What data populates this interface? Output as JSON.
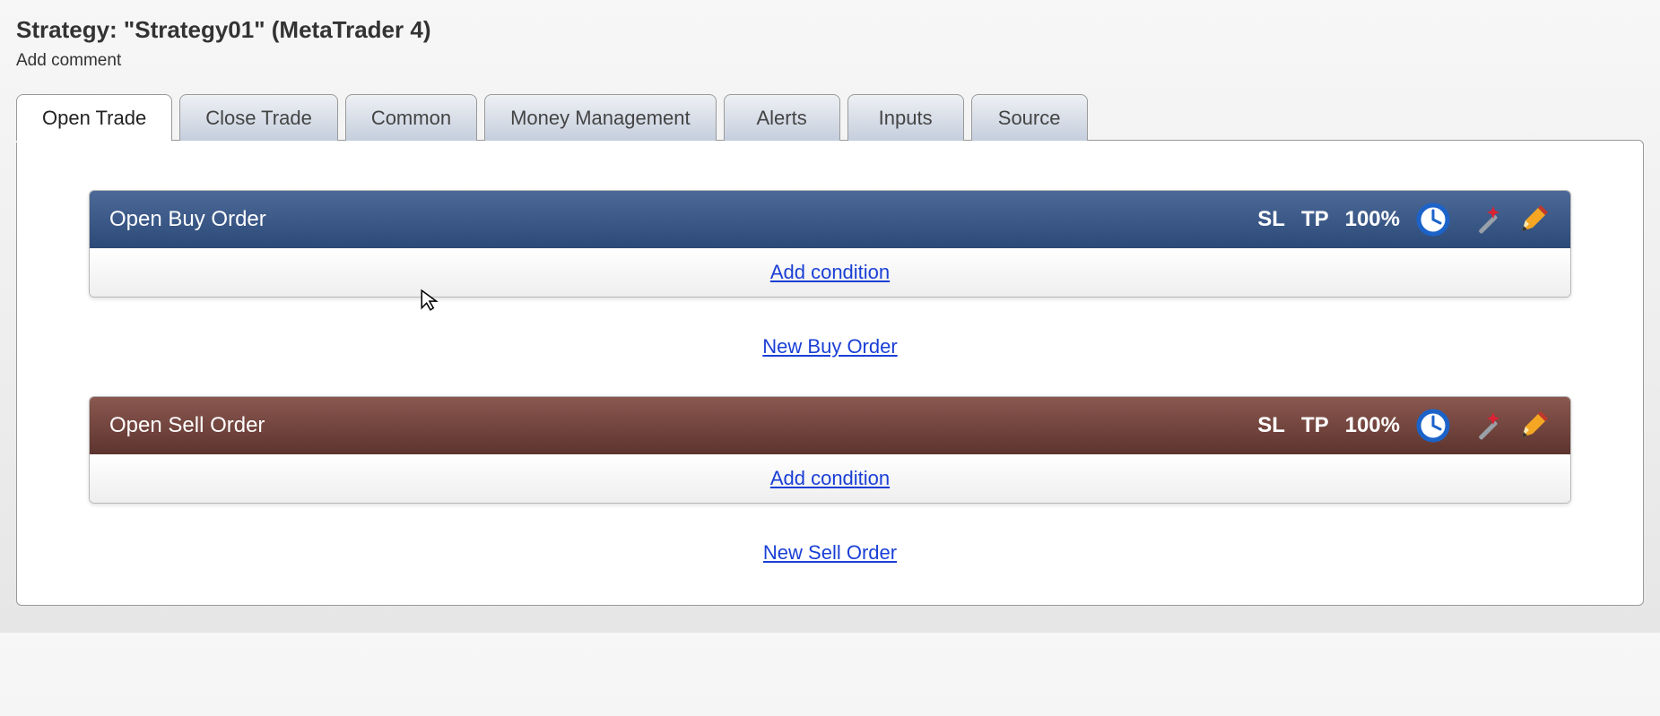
{
  "header": {
    "title": "Strategy: \"Strategy01\" (MetaTrader 4)",
    "add_comment": "Add comment"
  },
  "tabs": {
    "open_trade": "Open Trade",
    "close_trade": "Close Trade",
    "common": "Common",
    "money_mgmt": "Money Management",
    "alerts": "Alerts",
    "inputs": "Inputs",
    "source": "Source"
  },
  "buy": {
    "title": "Open Buy Order",
    "sl": "SL",
    "tp": "TP",
    "pct": "100%",
    "add_condition": "Add condition",
    "new_order": "New Buy Order"
  },
  "sell": {
    "title": "Open Sell Order",
    "sl": "SL",
    "tp": "TP",
    "pct": "100%",
    "add_condition": "Add condition",
    "new_order": "New Sell Order"
  }
}
